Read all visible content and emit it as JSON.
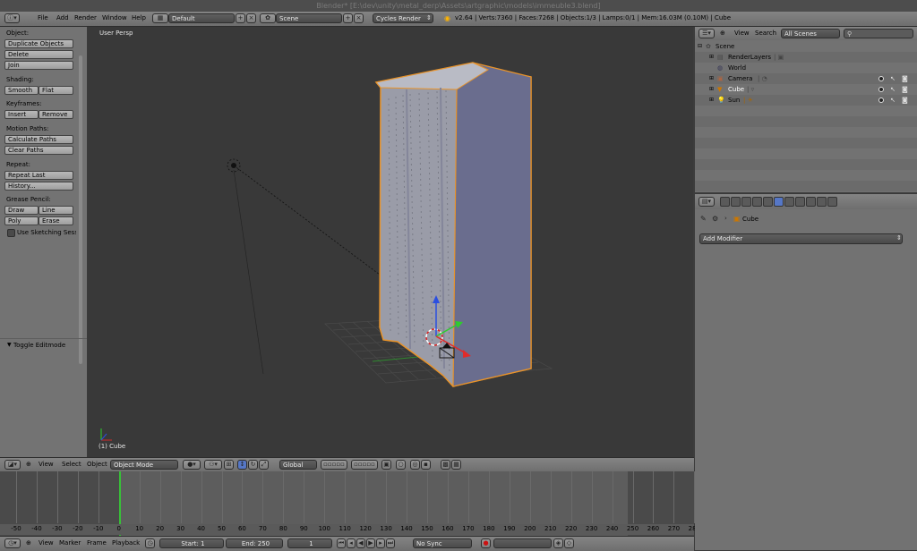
{
  "title_bar": "Blender* [E:\\dev\\unity\\metal_derp\\Assets\\artgraphic\\models\\immeuble3.blend]",
  "info_header": {
    "menus": [
      "File",
      "Add",
      "Render",
      "Window",
      "Help"
    ],
    "screen_layout": "Default",
    "scene": "Scene",
    "render_engine": "Cycles Render",
    "stats": "v2.64 | Verts:7360 | Faces:7268 | Objects:1/3 | Lamps:0/1 | Mem:16.03M (0.10M) | Cube"
  },
  "tool_shelf": {
    "object_label": "Object:",
    "duplicate": "Duplicate Objects",
    "delete": "Delete",
    "join": "Join",
    "shading_label": "Shading:",
    "smooth": "Smooth",
    "flat": "Flat",
    "keyframes_label": "Keyframes:",
    "insert": "Insert",
    "remove": "Remove",
    "motion_label": "Motion Paths:",
    "calc_paths": "Calculate Paths",
    "clear_paths": "Clear Paths",
    "repeat_label": "Repeat:",
    "repeat_last": "Repeat Last",
    "history": "History...",
    "grease_label": "Grease Pencil:",
    "draw": "Draw",
    "line": "Line",
    "poly": "Poly",
    "erase": "Erase",
    "sketching": "Use Sketching Sessio",
    "toggle_editmode": "Toggle Editmode"
  },
  "viewport": {
    "view_name": "User Persp",
    "active_object": "(1) Cube"
  },
  "view3d_header": {
    "menus": [
      "View",
      "Select",
      "Object"
    ],
    "mode": "Object Mode",
    "orientation": "Global"
  },
  "timeline": {
    "ruler": [
      "-50",
      "-40",
      "-30",
      "-20",
      "-10",
      "0",
      "10",
      "20",
      "30",
      "40",
      "50",
      "60",
      "70",
      "80",
      "90",
      "100",
      "110",
      "120",
      "130",
      "140",
      "150",
      "160",
      "170",
      "180",
      "190",
      "200",
      "210",
      "220",
      "230",
      "240",
      "250",
      "260",
      "270",
      "280"
    ],
    "current_frame_value": 0,
    "menus": [
      "View",
      "Marker",
      "Frame",
      "Playback"
    ],
    "start": "Start: 1",
    "end": "End: 250",
    "current": "1",
    "sync": "No Sync"
  },
  "outliner": {
    "menus": [
      "View",
      "Search"
    ],
    "filter": "All Scenes",
    "items": [
      "Scene",
      "RenderLayers",
      "World",
      "Camera",
      "Cube",
      "Sun"
    ]
  },
  "properties": {
    "breadcrumb": "Cube",
    "add_modifier": "Add Modifier"
  },
  "colors": {
    "selection_outline": "#e8932a",
    "building_face": "#9a9ca8",
    "building_side": "#6a6d8e",
    "current_frame_line": "#38c038"
  }
}
